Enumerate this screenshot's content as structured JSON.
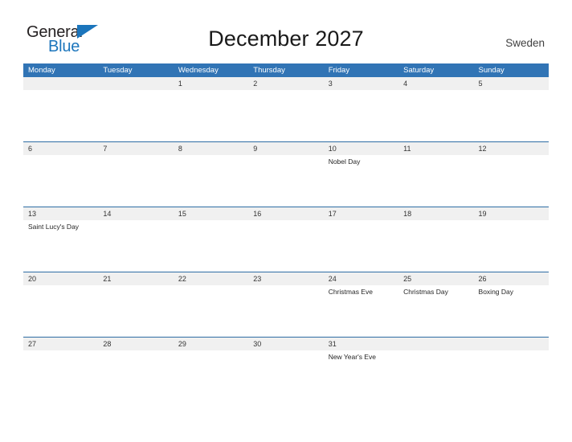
{
  "brand": {
    "word_one": "General",
    "word_two": "Blue",
    "flag_icon": "triangle-flag-icon",
    "accent_color": "#1b75bc"
  },
  "header": {
    "title": "December 2027",
    "country": "Sweden"
  },
  "colors": {
    "header_bar": "#3174b5",
    "date_band": "#f0f0f0",
    "row_divider": "#2e6da4",
    "title_text": "#1a1a1a"
  },
  "calendar": {
    "weekdays": [
      "Monday",
      "Tuesday",
      "Wednesday",
      "Thursday",
      "Friday",
      "Saturday",
      "Sunday"
    ],
    "weeks": [
      {
        "days": [
          {
            "date": "",
            "events": []
          },
          {
            "date": "",
            "events": []
          },
          {
            "date": "1",
            "events": []
          },
          {
            "date": "2",
            "events": []
          },
          {
            "date": "3",
            "events": []
          },
          {
            "date": "4",
            "events": []
          },
          {
            "date": "5",
            "events": []
          }
        ]
      },
      {
        "days": [
          {
            "date": "6",
            "events": []
          },
          {
            "date": "7",
            "events": []
          },
          {
            "date": "8",
            "events": []
          },
          {
            "date": "9",
            "events": []
          },
          {
            "date": "10",
            "events": [
              "Nobel Day"
            ]
          },
          {
            "date": "11",
            "events": []
          },
          {
            "date": "12",
            "events": []
          }
        ]
      },
      {
        "days": [
          {
            "date": "13",
            "events": [
              "Saint Lucy's Day"
            ]
          },
          {
            "date": "14",
            "events": []
          },
          {
            "date": "15",
            "events": []
          },
          {
            "date": "16",
            "events": []
          },
          {
            "date": "17",
            "events": []
          },
          {
            "date": "18",
            "events": []
          },
          {
            "date": "19",
            "events": []
          }
        ]
      },
      {
        "days": [
          {
            "date": "20",
            "events": []
          },
          {
            "date": "21",
            "events": []
          },
          {
            "date": "22",
            "events": []
          },
          {
            "date": "23",
            "events": []
          },
          {
            "date": "24",
            "events": [
              "Christmas Eve"
            ]
          },
          {
            "date": "25",
            "events": [
              "Christmas Day"
            ]
          },
          {
            "date": "26",
            "events": [
              "Boxing Day"
            ]
          }
        ]
      },
      {
        "days": [
          {
            "date": "27",
            "events": []
          },
          {
            "date": "28",
            "events": []
          },
          {
            "date": "29",
            "events": []
          },
          {
            "date": "30",
            "events": []
          },
          {
            "date": "31",
            "events": [
              "New Year's Eve"
            ]
          },
          {
            "date": "",
            "events": []
          },
          {
            "date": "",
            "events": []
          }
        ]
      }
    ]
  }
}
